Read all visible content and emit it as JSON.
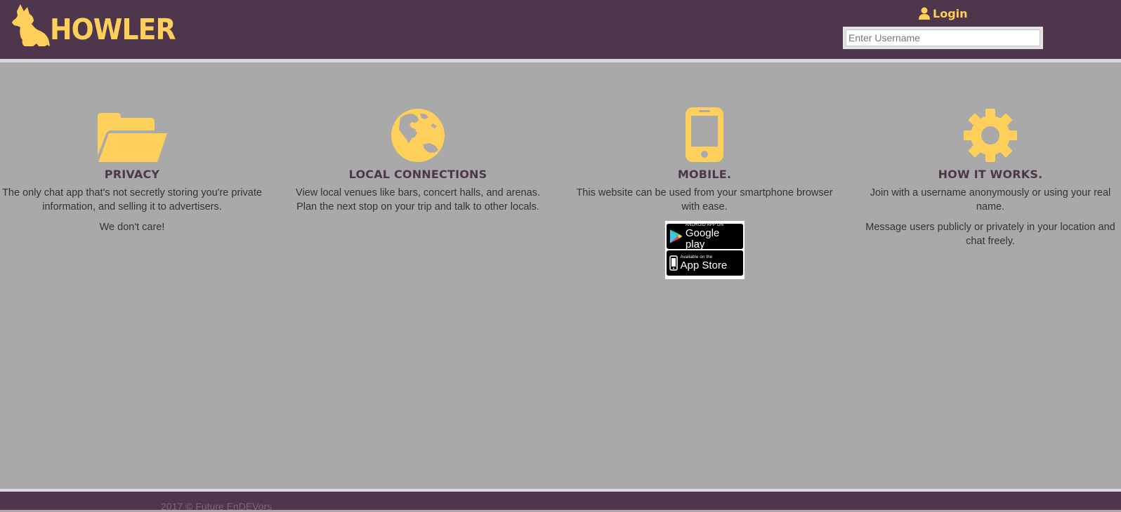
{
  "header": {
    "brand": "HOWLER",
    "logo_icon": "wolf-icon",
    "login": {
      "icon": "user-icon",
      "label": "Login",
      "placeholder": "Enter Username"
    }
  },
  "features": [
    {
      "icon": "folder-open-icon",
      "title": "PRIVACY",
      "paragraphs": [
        "The only chat app that's not secretly storing you're private information, and selling it to advertisers.",
        "We don't care!"
      ]
    },
    {
      "icon": "globe-icon",
      "title": "LOCAL CONNECTIONS",
      "paragraphs": [
        "View local venues like bars, concert halls, and arenas. Plan the next stop on your trip and talk to other locals."
      ]
    },
    {
      "icon": "mobile-phone-icon",
      "title": "MOBILE.",
      "paragraphs": [
        "This website can be used from your smartphone browser with ease."
      ],
      "badges": {
        "google_small": "ANDROID APP ON",
        "google_big": "Google play",
        "apple_small": "Available on the",
        "apple_big": "App Store"
      }
    },
    {
      "icon": "gear-icon",
      "title": "HOW IT WORKS.",
      "paragraphs": [
        "Join with a username anonymously or using your real name.",
        "Message users publicly or privately in your location and chat freely."
      ]
    }
  ],
  "footer": {
    "copyright": "2017 © Future EnDEVors"
  },
  "colors": {
    "header_bg": "#4e364c",
    "accent_yellow": "#fecf5a",
    "body_bg": "#a9a9a9",
    "rule": "#d8d8d8"
  }
}
